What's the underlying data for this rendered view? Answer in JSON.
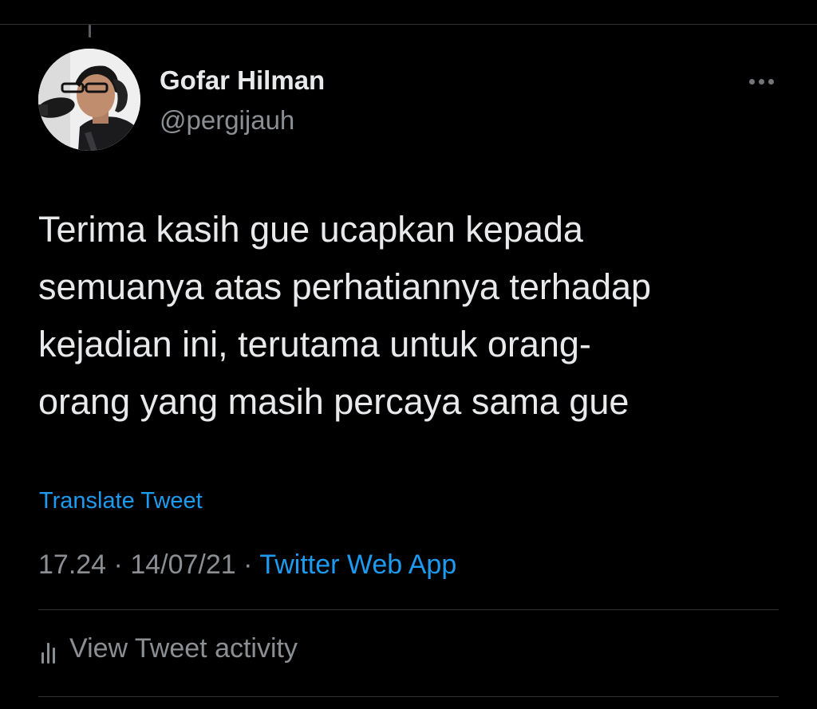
{
  "user": {
    "display_name": "Gofar Hilman",
    "handle": "@pergijauh",
    "avatar_icon": "profile-photo"
  },
  "menu": {
    "icon": "more-horizontal-icon"
  },
  "tweet": {
    "lines": [
      "Terima kasih gue ucapkan kepada",
      "semuanya atas perhatiannya terhadap",
      "kejadian ini, terutama untuk orang-",
      "orang yang masih percaya sama gue"
    ],
    "translate_label": "Translate Tweet",
    "time": "17.24",
    "date": "14/07/21",
    "separator": "·",
    "source": "Twitter Web App"
  },
  "activity": {
    "label": "View Tweet activity",
    "icon": "bar-chart-icon"
  },
  "colors": {
    "background": "#000000",
    "text_primary": "#e7e9ea",
    "text_secondary": "#8b8f93",
    "accent": "#1d9bf0",
    "divider": "#2f3336"
  }
}
